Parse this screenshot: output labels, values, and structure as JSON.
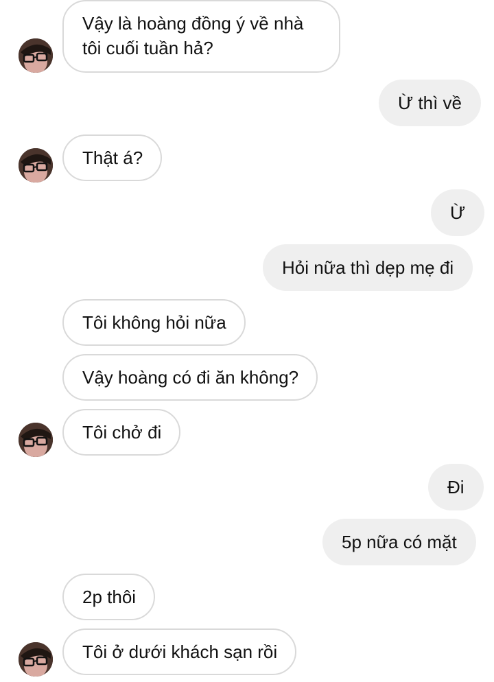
{
  "conversation": {
    "messages": [
      {
        "side": "incoming",
        "text": "Vậy là hoàng đồng ý về nhà tôi cuối tuần hả?"
      },
      {
        "side": "outgoing",
        "text": "Ừ thì về"
      },
      {
        "side": "incoming",
        "text": "Thật á?"
      },
      {
        "side": "outgoing",
        "text": "Ừ"
      },
      {
        "side": "outgoing",
        "text": "Hỏi nữa thì dẹp mẹ đi"
      },
      {
        "side": "incoming",
        "text": "Tôi không hỏi nữa"
      },
      {
        "side": "incoming",
        "text": "Vậy hoàng có đi ăn không?"
      },
      {
        "side": "incoming",
        "text": "Tôi chở đi"
      },
      {
        "side": "outgoing",
        "text": "Đi"
      },
      {
        "side": "outgoing",
        "text": "5p nữa có mặt"
      },
      {
        "side": "incoming",
        "text": "2p thôi"
      },
      {
        "side": "incoming",
        "text": "Tôi ở dưới khách sạn rồi"
      }
    ]
  },
  "colors": {
    "incoming_bubble_border": "#d9d9d9",
    "outgoing_bubble_fill": "#efefef",
    "text": "#111111"
  },
  "icons": {
    "avatar": "avatar-icon"
  }
}
